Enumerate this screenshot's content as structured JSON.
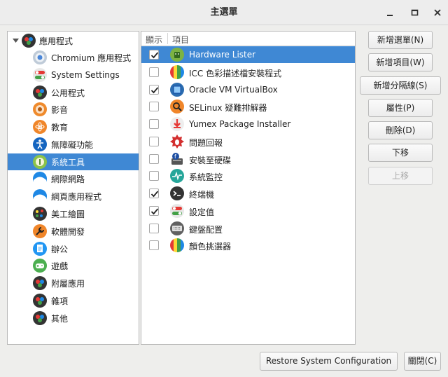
{
  "window": {
    "title": "主選單",
    "minimize_icon": "minimize-icon",
    "maximize_icon": "maximize-icon",
    "close_icon": "close-icon"
  },
  "tree": {
    "root": {
      "label": "應用程式",
      "icon": "applications-icon",
      "expanded": true
    },
    "items": [
      {
        "label": "Chromium 應用程式",
        "icon": "chromium-icon"
      },
      {
        "label": "System Settings",
        "icon": "settings-toggle-icon"
      },
      {
        "label": "公用程式",
        "icon": "utilities-icon"
      },
      {
        "label": "影音",
        "icon": "multimedia-icon"
      },
      {
        "label": "教育",
        "icon": "education-icon"
      },
      {
        "label": "無障礙功能",
        "icon": "accessibility-icon"
      },
      {
        "label": "系統工具",
        "icon": "system-tools-icon",
        "selected": true
      },
      {
        "label": "網際網路",
        "icon": "internet-icon"
      },
      {
        "label": "網頁應用程式",
        "icon": "web-apps-icon"
      },
      {
        "label": "美工繪圖",
        "icon": "graphics-icon"
      },
      {
        "label": "軟體開發",
        "icon": "development-icon"
      },
      {
        "label": "辦公",
        "icon": "office-icon"
      },
      {
        "label": "遊戲",
        "icon": "games-icon"
      },
      {
        "label": "附屬應用",
        "icon": "accessories-icon"
      },
      {
        "label": "雜項",
        "icon": "misc-icon"
      },
      {
        "label": "其他",
        "icon": "other-icon"
      }
    ]
  },
  "list": {
    "col_show": "顯示",
    "col_item": "項目",
    "items": [
      {
        "label": "Hardware Lister",
        "checked": true,
        "selected": true,
        "icon": "hardware-lister-icon"
      },
      {
        "label": "ICC 色彩描述檔安裝程式",
        "checked": false,
        "icon": "color-profile-icon"
      },
      {
        "label": "Oracle VM VirtualBox",
        "checked": true,
        "icon": "virtualbox-icon"
      },
      {
        "label": "SELinux 疑難排解器",
        "checked": false,
        "icon": "selinux-icon"
      },
      {
        "label": "Yumex Package Installer",
        "checked": false,
        "icon": "yumex-icon"
      },
      {
        "label": "問題回報",
        "checked": false,
        "icon": "bug-report-icon"
      },
      {
        "label": "安裝至硬碟",
        "checked": false,
        "icon": "install-to-disk-icon"
      },
      {
        "label": "系統監控",
        "checked": false,
        "icon": "system-monitor-icon"
      },
      {
        "label": "終端機",
        "checked": true,
        "icon": "terminal-icon"
      },
      {
        "label": "設定值",
        "checked": true,
        "icon": "settings-icon"
      },
      {
        "label": "鍵盤配置",
        "checked": false,
        "icon": "keyboard-icon"
      },
      {
        "label": "顏色挑選器",
        "checked": false,
        "icon": "color-picker-icon"
      }
    ]
  },
  "buttons": {
    "new_menu": "新增選單(N)",
    "new_item": "新增項目(W)",
    "new_separator": "新增分隔線(S)",
    "properties": "屬性(P)",
    "delete": "刪除(D)",
    "move_down": "下移",
    "move_up": "上移",
    "restore": "Restore System Configuration",
    "close": "關閉(C)"
  },
  "colors": {
    "selection": "#3f88d4",
    "window_bg": "#eeeeec"
  }
}
